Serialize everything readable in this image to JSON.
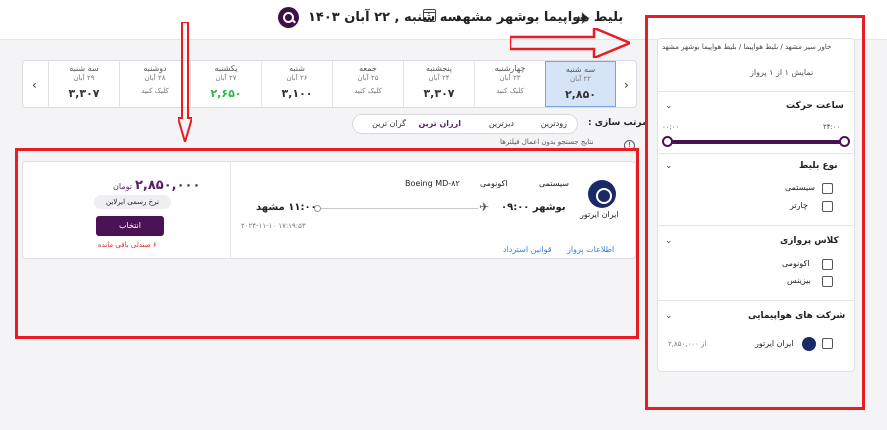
{
  "header": {
    "route": "بلیط هواپیما بوشهر مشهد",
    "date": "سه شنبه , ۲۲ آبان ۱۴۰۳"
  },
  "dates": [
    {
      "day": "سه شنبه",
      "date": "۲۹ آبان",
      "price": "۳,۳۰۷",
      "state": "normal"
    },
    {
      "day": "دوشنبه",
      "date": "۲۸ آبان",
      "price": "کلیک کنید",
      "state": "small"
    },
    {
      "day": "یکشنبه",
      "date": "۲۷ آبان",
      "price": "۲,۶۵۰",
      "state": "green"
    },
    {
      "day": "شنبه",
      "date": "۲۶ آبان",
      "price": "۳,۱۰۰",
      "state": "normal"
    },
    {
      "day": "جمعه",
      "date": "۲۵ آبان",
      "price": "کلیک کنید",
      "state": "small"
    },
    {
      "day": "پنجشنبه",
      "date": "۲۴ آبان",
      "price": "۳,۳۰۷",
      "state": "normal"
    },
    {
      "day": "چهارشنبه",
      "date": "۲۳ آبان",
      "price": "کلیک کنید",
      "state": "small"
    },
    {
      "day": "سه شنبه",
      "date": "۲۲ آبان",
      "price": "۲,۸۵۰",
      "state": "active"
    }
  ],
  "sort": {
    "label": "مرتب سازی :",
    "options": [
      "زودترین",
      "دیرترین",
      "ارزان ترین",
      "گران ترین"
    ],
    "active_index": 2,
    "hint": "نتایج جستجو بدون اعمال فیلترها"
  },
  "flight": {
    "airline": "ایران ایرتور",
    "system": "سیستمی",
    "class": "اکونومی",
    "aircraft": "Boeing MD-۸۲",
    "dep": "بوشهر  ۰۹:۰۰",
    "arr": "۱۱:۰۰  مشهد",
    "stamp": "۲۰۲۴-۱۱-۱۰ ۱۷:۱۹:۵۳",
    "link_info": "اطلاعات پرواز",
    "link_refund": "قوانین استرداد",
    "price": "۲,۸۵۰,۰۰۰",
    "currency": "تومان",
    "fare": "نرخ رسمی ایرلاین",
    "select": "انتخاب",
    "remain": "۶ صندلی باقی مانده"
  },
  "sidebar": {
    "crumb": "خاور سیر مشهد / بلیط هواپیما / بلیط هواپیما بوشهر مشهد",
    "count": "نمایش ۱ از ۱ پرواز",
    "time_title": "ساعت حرکت",
    "time_min": "۰۰:۰۰",
    "time_max": "۲۴:۰۰",
    "type_title": "نوع بلیط",
    "types": [
      "سیستمی",
      "چارتر"
    ],
    "class_title": "کلاس پروازی",
    "classes": [
      "اکونومی",
      "بیزینس"
    ],
    "airline_title": "شرکت های هواپیمایی",
    "airline": "ایران ایرتور",
    "airline_price": "از ۲,۸۵۰,۰۰۰"
  }
}
